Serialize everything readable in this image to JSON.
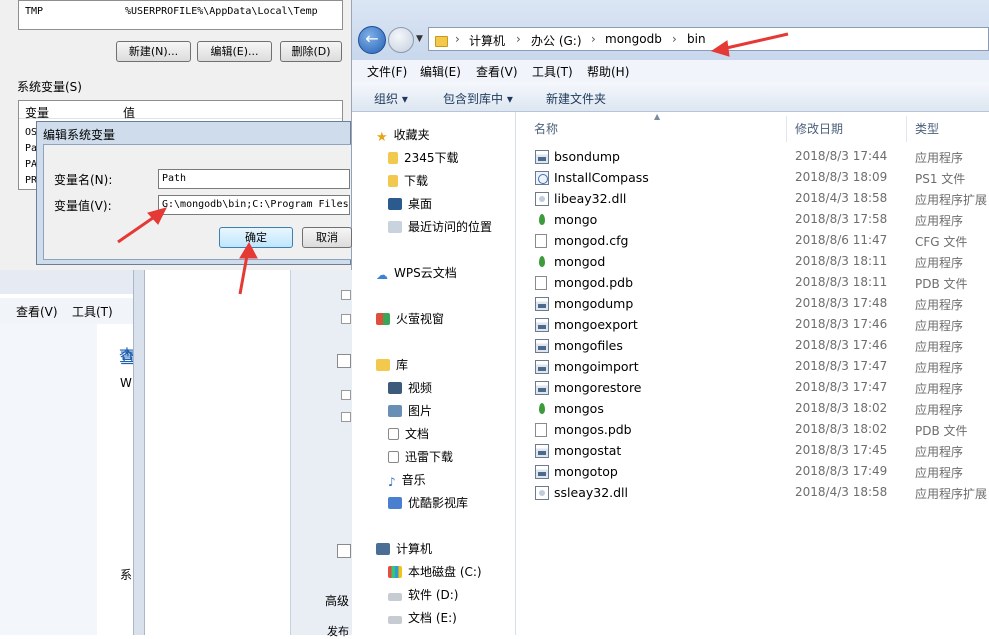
{
  "env_window": {
    "tmp_name": "TMP",
    "tmp_value": "%USERPROFILE%\\AppData\\Local\\Temp",
    "btn_new": "新建(N)...",
    "btn_edit": "编辑(E)...",
    "btn_delete": "删除(D)",
    "sys_vars_label": "系统变量(S)",
    "col_var": "变量",
    "col_val": "值",
    "row_os": "OS",
    "row_pa1": "Pa",
    "row_pa2": "PA",
    "row_pr": "PR"
  },
  "edit_dialog": {
    "title": "编辑系统变量",
    "name_label": "变量名(N):",
    "name_value": "Path",
    "value_label": "变量值(V):",
    "value_value": "G:\\mongodb\\bin;C:\\Program Files",
    "ok": "确定",
    "cancel": "取消"
  },
  "bg_window": {
    "menu_view": "查看(V)",
    "menu_tools": "工具(T)",
    "frag1": "查",
    "frag2": "W",
    "frag3": "系",
    "frag_adv": "高级",
    "frag_pub": "发布"
  },
  "explorer": {
    "breadcrumb": [
      "计算机",
      "办公 (G:)",
      "mongodb",
      "bin"
    ],
    "menu": [
      "文件(F)",
      "编辑(E)",
      "查看(V)",
      "工具(T)",
      "帮助(H)"
    ],
    "commands": [
      "组织 ▾",
      "包含到库中 ▾",
      "新建文件夹"
    ],
    "nav": {
      "favorites": "收藏夹",
      "fav_items": [
        "2345下载",
        "下载",
        "桌面",
        "最近访问的位置"
      ],
      "wps": "WPS云文档",
      "firefly": "火萤视窗",
      "library": "库",
      "lib_items": [
        "视频",
        "图片",
        "文档",
        "迅雷下载",
        "音乐",
        "优酷影视库"
      ],
      "computer": "计算机",
      "drives": [
        "本地磁盘 (C:)",
        "软件 (D:)",
        "文档 (E:)"
      ]
    },
    "columns": {
      "name": "名称",
      "date": "修改日期",
      "type": "类型"
    },
    "files": [
      {
        "name": "bsondump",
        "date": "2018/8/3 17:44",
        "type": "应用程序",
        "icon": "exe"
      },
      {
        "name": "InstallCompass",
        "date": "2018/8/3 18:09",
        "type": "PS1 文件",
        "icon": "ps"
      },
      {
        "name": "libeay32.dll",
        "date": "2018/4/3 18:58",
        "type": "应用程序扩展",
        "icon": "dll"
      },
      {
        "name": "mongo",
        "date": "2018/8/3 17:58",
        "type": "应用程序",
        "icon": "leaf"
      },
      {
        "name": "mongod.cfg",
        "date": "2018/8/6 11:47",
        "type": "CFG 文件",
        "icon": "doc"
      },
      {
        "name": "mongod",
        "date": "2018/8/3 18:11",
        "type": "应用程序",
        "icon": "leaf"
      },
      {
        "name": "mongod.pdb",
        "date": "2018/8/3 18:11",
        "type": "PDB 文件",
        "icon": "doc"
      },
      {
        "name": "mongodump",
        "date": "2018/8/3 17:48",
        "type": "应用程序",
        "icon": "exe"
      },
      {
        "name": "mongoexport",
        "date": "2018/8/3 17:46",
        "type": "应用程序",
        "icon": "exe"
      },
      {
        "name": "mongofiles",
        "date": "2018/8/3 17:46",
        "type": "应用程序",
        "icon": "exe"
      },
      {
        "name": "mongoimport",
        "date": "2018/8/3 17:47",
        "type": "应用程序",
        "icon": "exe"
      },
      {
        "name": "mongorestore",
        "date": "2018/8/3 17:47",
        "type": "应用程序",
        "icon": "exe"
      },
      {
        "name": "mongos",
        "date": "2018/8/3 18:02",
        "type": "应用程序",
        "icon": "leaf"
      },
      {
        "name": "mongos.pdb",
        "date": "2018/8/3 18:02",
        "type": "PDB 文件",
        "icon": "doc"
      },
      {
        "name": "mongostat",
        "date": "2018/8/3 17:45",
        "type": "应用程序",
        "icon": "exe"
      },
      {
        "name": "mongotop",
        "date": "2018/8/3 17:49",
        "type": "应用程序",
        "icon": "exe"
      },
      {
        "name": "ssleay32.dll",
        "date": "2018/4/3 18:58",
        "type": "应用程序扩展",
        "icon": "dll"
      }
    ]
  },
  "colors": {
    "arrow": "#e53935",
    "accent": "#2561b5"
  }
}
